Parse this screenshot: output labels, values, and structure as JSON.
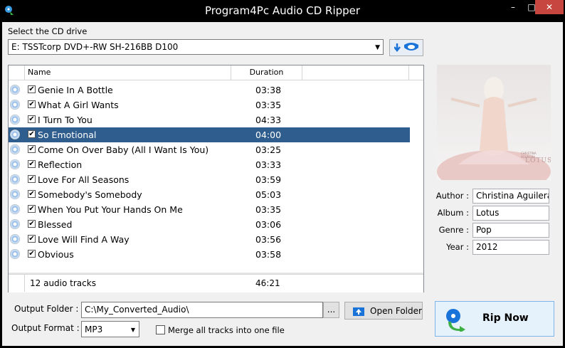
{
  "window": {
    "title": "Program4Pc Audio CD Ripper",
    "minimize": "–",
    "maximize": "□",
    "close": "✕"
  },
  "drive": {
    "label": "Select the CD drive",
    "selected": "E: TSSTcorp DVD+-RW SH-216BB D100"
  },
  "list": {
    "columns": {
      "name": "Name",
      "duration": "Duration"
    },
    "tracks": [
      {
        "name": "Genie In A Bottle",
        "duration": "03:38",
        "checked": true
      },
      {
        "name": "What A Girl Wants",
        "duration": "03:35",
        "checked": true
      },
      {
        "name": "I Turn To You",
        "duration": "04:33",
        "checked": true
      },
      {
        "name": "So Emotional",
        "duration": "04:00",
        "checked": true,
        "selected": true
      },
      {
        "name": "Come On Over Baby (All I Want Is You)",
        "duration": "03:25",
        "checked": true
      },
      {
        "name": "Reflection",
        "duration": "03:33",
        "checked": true
      },
      {
        "name": "Love For All Seasons",
        "duration": "03:59",
        "checked": true
      },
      {
        "name": "Somebody's Somebody",
        "duration": "05:03",
        "checked": true
      },
      {
        "name": "When You Put Your Hands On Me",
        "duration": "03:35",
        "checked": true
      },
      {
        "name": "Blessed",
        "duration": "03:06",
        "checked": true
      },
      {
        "name": "Love Will Find A Way",
        "duration": "03:56",
        "checked": true
      },
      {
        "name": "Obvious",
        "duration": "03:58",
        "checked": true
      }
    ],
    "footer": {
      "count": "12 audio tracks",
      "total": "46:21"
    }
  },
  "album_art": {
    "text": "LOTUS",
    "artist_small": "CHRISTINA AGUILERA"
  },
  "info": {
    "author_label": "Author :",
    "author": "Christina Aguilera",
    "album_label": "Album :",
    "album": "Lotus",
    "genre_label": "Genre :",
    "genre": "Pop",
    "year_label": "Year :",
    "year": "2012"
  },
  "output": {
    "folder_label": "Output Folder :",
    "folder": "C:\\My_Converted_Audio\\",
    "browse": "...",
    "open_folder": "Open Folder",
    "format_label": "Output Format :",
    "format": "MP3",
    "merge": "Merge all tracks into one file"
  },
  "rip": {
    "label": "Rip Now"
  },
  "colors": {
    "selection": "#2f5d8d",
    "close": "#c7463f",
    "accent": "#1a73d9"
  }
}
